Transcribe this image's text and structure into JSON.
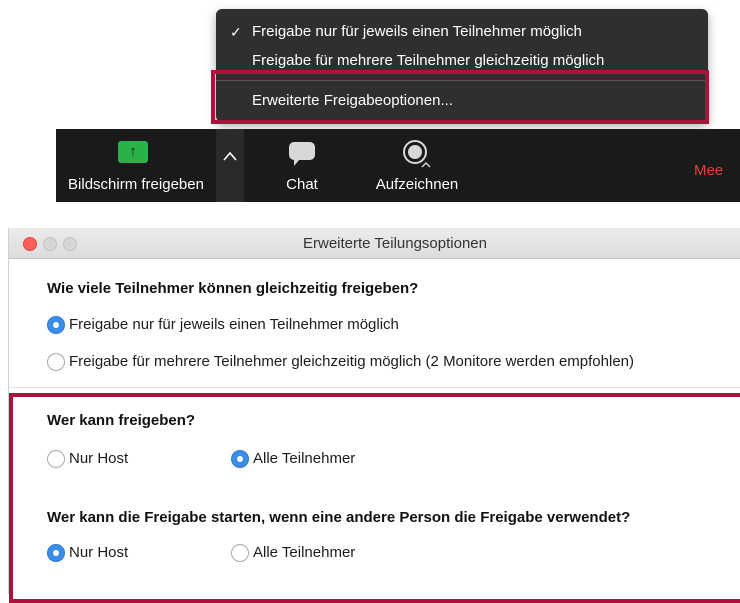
{
  "menu": {
    "items": [
      {
        "label": "Freigabe nur für jeweils einen Teilnehmer möglich",
        "checked": true
      },
      {
        "label": "Freigabe für mehrere Teilnehmer gleichzeitig möglich",
        "checked": false
      },
      {
        "label": "Erweiterte Freigabeoptionen...",
        "checked": false
      }
    ],
    "check_glyph": "✓"
  },
  "toolbar": {
    "share_label": "Bildschirm freigeben",
    "share_icon_glyph": "↑",
    "chat_label": "Chat",
    "record_label": "Aufzeichnen",
    "meeting_text": "Mee"
  },
  "window": {
    "title": "Erweiterte Teilungsoptionen",
    "q1": {
      "heading": "Wie viele Teilnehmer können gleichzeitig freigeben?",
      "options": [
        {
          "label": "Freigabe nur für jeweils einen Teilnehmer möglich",
          "selected": true
        },
        {
          "label": "Freigabe für mehrere Teilnehmer gleichzeitig möglich (2 Monitore werden empfohlen)",
          "selected": false
        }
      ]
    },
    "q2": {
      "heading": "Wer kann freigeben?",
      "options": [
        {
          "label": "Nur Host",
          "selected": false
        },
        {
          "label": "Alle Teilnehmer",
          "selected": true
        }
      ]
    },
    "q3": {
      "heading": "Wer kann die Freigabe starten, wenn eine andere Person die Freigabe verwendet?",
      "options": [
        {
          "label": "Nur Host",
          "selected": true
        },
        {
          "label": "Alle Teilnehmer",
          "selected": false
        }
      ]
    }
  },
  "colors": {
    "highlight": "#b0113c",
    "radio_selected": "#3a8ee6",
    "share_green": "#2bb14a",
    "menu_bg": "#2f2f2f",
    "toolbar_bg": "#1a1a1a",
    "meeting_red": "#e0403a"
  }
}
